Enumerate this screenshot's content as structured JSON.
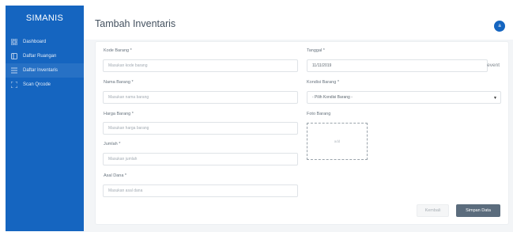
{
  "sidebar": {
    "brand": "SIMANIS",
    "items": [
      {
        "label": "Dashboard",
        "icon": "grid-icon"
      },
      {
        "label": "Daftar Ruangan",
        "icon": "square-icon"
      },
      {
        "label": "Daftar Inventaris",
        "icon": "list-icon"
      },
      {
        "label": "Scan Qrcode",
        "icon": "scan-icon"
      }
    ],
    "active_index": 2
  },
  "header": {
    "title": "Tambah Inventaris",
    "avatar_text": "a"
  },
  "form": {
    "kode": {
      "label": "Kode Barang *",
      "placeholder": "Masukan kode barang"
    },
    "nama": {
      "label": "Nama Barang *",
      "placeholder": "Masukan nama barang"
    },
    "harga": {
      "label": "Harga Barang *",
      "placeholder": "Masukan harga barang"
    },
    "jumlah": {
      "label": "Jumlah *",
      "placeholder": "Masukan jumlah"
    },
    "asal": {
      "label": "Asal Dana *",
      "placeholder": "Masukan asal dana"
    },
    "tanggal": {
      "label": "Tanggal *",
      "value": "11/11/2019",
      "side_text": "event"
    },
    "kondisi": {
      "label": "Kondisi Barang *",
      "selected": "- Pilih Kondisi Barang -"
    },
    "foto": {
      "label": "Foto Barang",
      "placeholder": "add"
    }
  },
  "actions": {
    "back_label": "Kembali",
    "save_label": "Simpan Data"
  },
  "colors": {
    "sidebar": "#1565c0",
    "primary_button": "#5b6c7d",
    "avatar": "#1565c0"
  }
}
